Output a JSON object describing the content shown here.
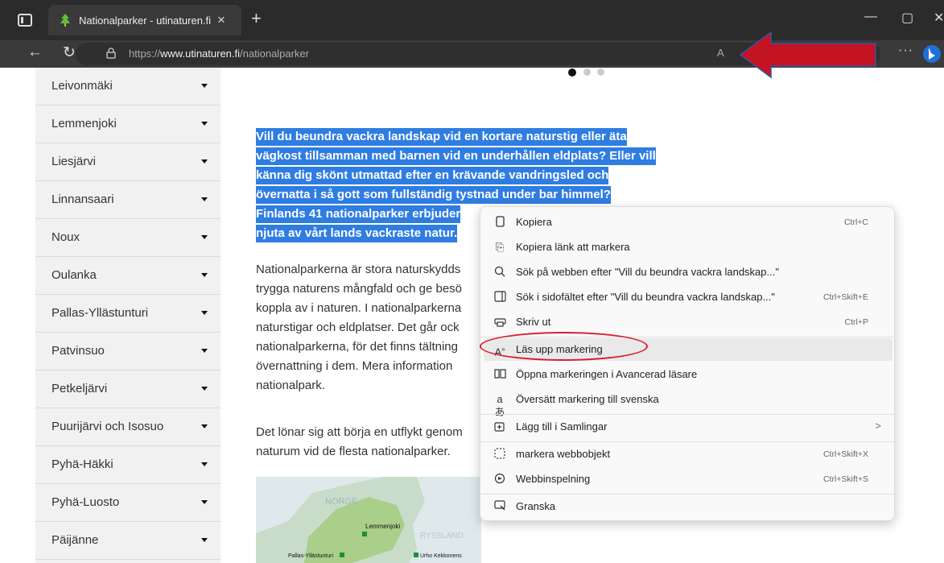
{
  "browser": {
    "tab_title": "Nationalparker - utinaturen.fi",
    "tab_close": "×",
    "new_tab": "+",
    "url_prefix": "https://",
    "url_domain": "www.utinaturen.fi",
    "url_path": "/nationalparker",
    "read_aloud_icon": "A",
    "more_label": "···"
  },
  "sidebar": {
    "items": [
      {
        "label": "Leivonmäki"
      },
      {
        "label": "Lemmenjoki"
      },
      {
        "label": "Liesjärvi"
      },
      {
        "label": "Linnansaari"
      },
      {
        "label": "Noux"
      },
      {
        "label": "Oulanka"
      },
      {
        "label": "Pallas-Yllästunturi"
      },
      {
        "label": "Patvinsuo"
      },
      {
        "label": "Petkeljärvi"
      },
      {
        "label": "Puurijärvi och Isosuo"
      },
      {
        "label": "Pyhä-Häkki"
      },
      {
        "label": "Pyhä-Luosto"
      },
      {
        "label": "Päijänne"
      }
    ]
  },
  "main": {
    "highlighted_lines": [
      "Vill du beundra vackra landskap vid en kortare naturstig eller äta",
      "vägkost tillsamman med barnen vid en underhållen eldplats? Eller vill",
      "känna dig skönt utmattad efter en krävande vandringsled och",
      "övernatta i så gott som fullständig tystnad under bar himmel?",
      "Finlands 41 nationalparker erbjuder",
      "njuta av vårt lands vackraste natur."
    ],
    "paragraph1_lines": [
      "Nationalparkerna är stora naturskydds",
      "trygga naturens mångfald och ge besö",
      "koppla av i naturen. I nationalparkerna",
      "naturstigar och eldplatser. Det går ock",
      "nationalparkerna, för det finns tältning",
      "övernattning i dem. Mera information",
      "nationalpark."
    ],
    "paragraph2_lines": [
      "Det lönar sig att börja en utflykt genom",
      "naturum vid de flesta nationalparker."
    ],
    "map_labels": {
      "norge": "NORGE",
      "lemmenjoki": "Lemmenjoki",
      "ryssland": "RYSSLAND",
      "pallas": "Pallas-Yllästunturi",
      "urho": "Urho Kekkonens"
    }
  },
  "context_menu": {
    "items": [
      {
        "icon": "copy-icon",
        "label": "Kopiera",
        "shortcut": "Ctrl+C"
      },
      {
        "icon": "copy-link-icon",
        "label": "Kopiera länk att markera",
        "shortcut": ""
      },
      {
        "icon": "search-icon",
        "label": "Sök på webben efter \"Vill du beundra vackra landskap...\"",
        "shortcut": ""
      },
      {
        "icon": "sidebar-search-icon",
        "label": "Sök i sidofältet efter \"Vill du beundra vackra landskap...\"",
        "shortcut": "Ctrl+Skift+E"
      },
      {
        "icon": "print-icon",
        "label": "Skriv ut",
        "shortcut": "Ctrl+P"
      },
      {
        "icon": "read-aloud-icon",
        "label": "Läs upp markering",
        "shortcut": ""
      },
      {
        "icon": "immersive-reader-icon",
        "label": "Öppna markeringen i Avancerad läsare",
        "shortcut": ""
      },
      {
        "icon": "translate-icon",
        "label": "Översätt markering till svenska",
        "shortcut": ""
      },
      {
        "icon": "collections-icon",
        "label": "Lägg till i Samlingar",
        "shortcut": ""
      },
      {
        "icon": "web-select-icon",
        "label": "markera webbobjekt",
        "shortcut": "Ctrl+Skift+X"
      },
      {
        "icon": "web-capture-icon",
        "label": "Webbinspelning",
        "shortcut": "Ctrl+Skift+S"
      },
      {
        "icon": "inspect-icon",
        "label": "Granska",
        "shortcut": ""
      }
    ],
    "hovered_index": 5,
    "submenu_arrow": ">"
  },
  "colors": {
    "selection": "#2f7de1",
    "annotation_red": "#d41f2e",
    "chrome_dark": "#2b2b2b"
  }
}
